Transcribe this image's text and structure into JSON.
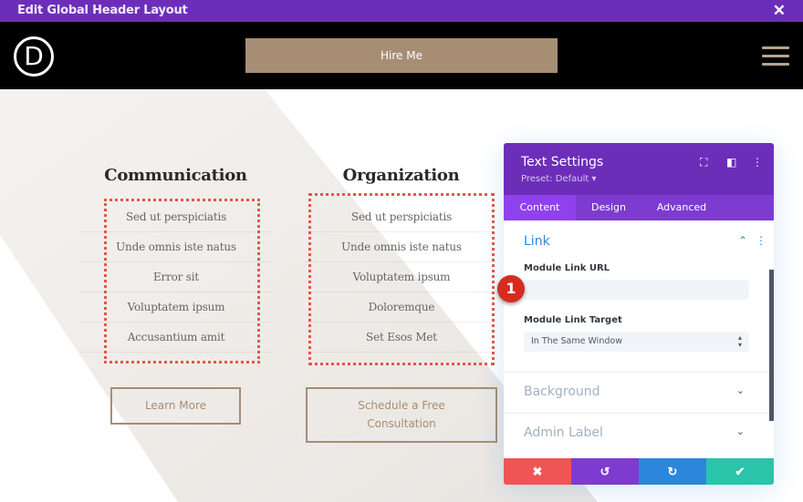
{
  "window": {
    "title": "Edit Global Header Layout",
    "close_icon": "close-icon"
  },
  "header": {
    "logo_letter": "D",
    "cta_label": "Hire Me",
    "menu_icon": "hamburger-icon"
  },
  "columns": [
    {
      "title": "Communication",
      "items": [
        "Sed ut perspiciatis",
        "Unde omnis iste natus",
        "Error sit",
        "Voluptatem ipsum",
        "Accusantium amit"
      ],
      "button_label": "Learn More"
    },
    {
      "title": "Organization",
      "items": [
        "Sed ut perspiciatis",
        "Unde omnis iste natus",
        "Voluptatem ipsum",
        "Doloremque",
        "Set Esos Met"
      ],
      "button_label": "Schedule a Free Consultation"
    }
  ],
  "panel": {
    "title": "Text Settings",
    "preset": "Preset: Default ▾",
    "header_icons": [
      "fullscreen-icon",
      "split-view-icon",
      "more-options-icon"
    ],
    "tabs": [
      {
        "label": "Content",
        "active": true
      },
      {
        "label": "Design",
        "active": false
      },
      {
        "label": "Advanced",
        "active": false
      }
    ],
    "open_section": {
      "title": "Link",
      "fields": [
        {
          "label": "Module Link URL",
          "value": "",
          "placeholder": ""
        },
        {
          "label": "Module Link Target",
          "value": "In The Same Window"
        }
      ]
    },
    "collapsed_sections": [
      "Background",
      "Admin Label"
    ],
    "footer": {
      "cancel_icon": "close-icon",
      "undo_icon": "undo-icon",
      "redo_icon": "redo-icon",
      "save_icon": "check-icon",
      "colors": {
        "cancel": "#ef5555",
        "undo": "#7e3bd0",
        "redo": "#2b87da",
        "save": "#29c4a9"
      }
    }
  },
  "annotation": {
    "badge_number": "1"
  },
  "colors": {
    "titlebar": "#6c2eb9",
    "accent_brown": "#a78d73",
    "dotted_outline": "#e4574a",
    "link_blue": "#2b87da"
  }
}
